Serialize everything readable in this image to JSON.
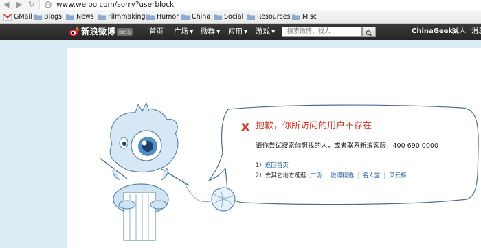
{
  "browser": {
    "url": "www.weibo.com/sorry?userblock",
    "bookmarks": [
      "GMail",
      "Blogs",
      "News",
      "Filmmaking",
      "Humor",
      "China",
      "Social",
      "Resources",
      "Misc"
    ]
  },
  "topnav": {
    "logo_text": "新浪微博",
    "badge": "beta",
    "links": [
      "首页",
      "广场",
      "微群",
      "应用",
      "游戏"
    ],
    "search_placeholder": "搜索微博、找人",
    "username": "ChinaGeeks",
    "extra_links": [
      "找人",
      "消息"
    ]
  },
  "error": {
    "title": "抱歉，你所访问的用户不存在",
    "message": "请你尝试搜索你想找的人，或者联系新浪客服：400 690 0000",
    "row1_prefix": "1）",
    "row1_link": "返回首页",
    "row2_prefix": "2）去其它地方逛逛:",
    "row2_links": [
      "广场",
      "微博精选",
      "名人堂",
      "风云榜"
    ]
  },
  "colors": {
    "accent_red": "#d83a2b",
    "link_blue": "#2a64b0",
    "page_bg": "#dceef5",
    "nav_bg": "#2f2f2f"
  }
}
